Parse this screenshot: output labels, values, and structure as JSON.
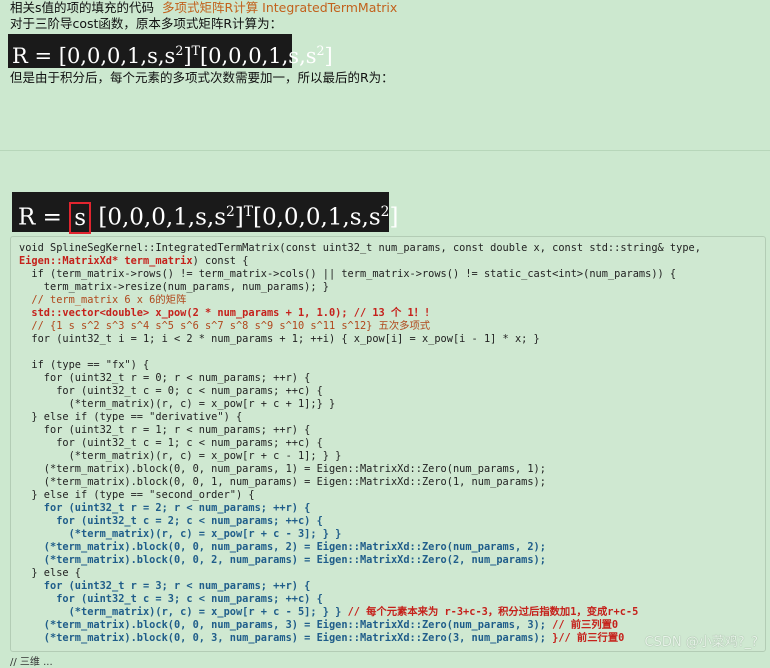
{
  "text": {
    "line1": "相关s值的项的填充的代码",
    "line1_link": "多项式矩阵R计算 IntegratedTermMatrix",
    "line2": "对于三阶导cost函数，原本多项式矩阵R计算为：",
    "line3": "但是由于积分后，每个元素的多项式次数需要加一，所以最后的R为：",
    "watermark": "CSDN @小菜鸡?_?",
    "bottom_cut": "// 三维 ..."
  },
  "formula1": {
    "lhs": "R = [0,0,0,1,s,s",
    "sup1": "2",
    "mid": "]",
    "supT": "T",
    "rhs": "[0,0,0,1,s,s",
    "sup2": "2",
    "end": "]"
  },
  "formula2": {
    "lhs": "R = ",
    "highlight": "s",
    "rest": " [0,0,0,1,s,s",
    "sup1": "2",
    "mid": "]",
    "supT": "T",
    "rhs": "[0,0,0,1,s,s",
    "sup2": "2",
    "end": "]"
  },
  "code": [
    [
      {
        "t": "void SplineSegKernel::IntegratedTermMatrix(const uint32_t num_params, const double x, const std::string& type,"
      }
    ],
    [
      {
        "t": "Eigen::MatrixXd* term_matrix",
        "s": "red"
      },
      {
        "t": ") const {"
      }
    ],
    [
      {
        "t": "  if (term_matrix->rows() != term_matrix->cols() || term_matrix->rows() != static_cast<int>(num_params)) {"
      }
    ],
    [
      {
        "t": "    term_matrix->resize(num_params, num_params); }"
      }
    ],
    [
      {
        "t": "  // term_matrix 6 x 6的矩阵",
        "s": "cmt"
      }
    ],
    [
      {
        "t": "  std::vector<double> x_pow(2 * num_params + 1, 1.0); // 13 个 1！!",
        "s": "red"
      }
    ],
    [
      {
        "t": "  // {1 s s^2 s^3 s^4 s^5 s^6 s^7 s^8 s^9 s^10 s^11 s^12} 五次多项式",
        "s": "cmt"
      }
    ],
    [
      {
        "t": "  for (uint32_t i = 1; i < 2 * num_params + 1; ++i) { x_pow[i] = x_pow[i - 1] * x; }"
      }
    ],
    [
      {
        "t": ""
      }
    ],
    [
      {
        "t": "  if (type == \"fx\") {"
      }
    ],
    [
      {
        "t": "    for (uint32_t r = 0; r < num_params; ++r) {"
      }
    ],
    [
      {
        "t": "      for (uint32_t c = 0; c < num_params; ++c) {"
      }
    ],
    [
      {
        "t": "        (*term_matrix)(r, c) = x_pow[r + c + 1];} }"
      }
    ],
    [
      {
        "t": "  } else if (type == \"derivative\") {"
      }
    ],
    [
      {
        "t": "    for (uint32_t r = 1; r < num_params; ++r) {"
      }
    ],
    [
      {
        "t": "      for (uint32_t c = 1; c < num_params; ++c) {"
      }
    ],
    [
      {
        "t": "        (*term_matrix)(r, c) = x_pow[r + c - 1]; } }"
      }
    ],
    [
      {
        "t": "    (*term_matrix).block(0, 0, num_params, 1) = Eigen::MatrixXd::Zero(num_params, 1);"
      }
    ],
    [
      {
        "t": "    (*term_matrix).block(0, 0, 1, num_params) = Eigen::MatrixXd::Zero(1, num_params);"
      }
    ],
    [
      {
        "t": "  } else if (type == \"second_order\") {"
      }
    ],
    [
      {
        "t": "    for (uint32_t r = 2; r < num_params; ++r) {",
        "s": "blue"
      }
    ],
    [
      {
        "t": "      for (uint32_t c = 2; c < num_params; ++c) {",
        "s": "blue"
      }
    ],
    [
      {
        "t": "        (*term_matrix)(r, c) = x_pow[r + c - 3]; } }",
        "s": "blue"
      }
    ],
    [
      {
        "t": "    (*term_matrix).block(0, 0, num_params, 2) = Eigen::MatrixXd::Zero(num_params, 2);",
        "s": "blue"
      }
    ],
    [
      {
        "t": "    (*term_matrix).block(0, 0, 2, num_params) = Eigen::MatrixXd::Zero(2, num_params);",
        "s": "blue"
      }
    ],
    [
      {
        "t": "  } else {"
      }
    ],
    [
      {
        "t": "    for (uint32_t r = 3; r < num_params; ++r) {",
        "s": "blue"
      }
    ],
    [
      {
        "t": "      for (uint32_t c = 3; c < num_params; ++c) {",
        "s": "blue"
      }
    ],
    [
      {
        "t": "        (*term_matrix)(r, c) = x_pow[r + c - 5]; } }",
        "s": "blue"
      },
      {
        "t": " // 每个元素本来为 r-3+c-3，积分过后指数加1，变成r+c-5",
        "s": "cmt2"
      }
    ],
    [
      {
        "t": "    (*term_matrix).block(0, 0, num_params, 3) = Eigen::MatrixXd::Zero(num_params, 3);",
        "s": "blue"
      },
      {
        "t": " // 前三列置0",
        "s": "cmt2"
      }
    ],
    [
      {
        "t": "    (*term_matrix).block(0, 0, 3, num_params) = Eigen::MatrixXd::Zero(3, num_params);",
        "s": "blue"
      },
      {
        "t": " }// 前三行置0",
        "s": "cmt2"
      }
    ]
  ]
}
